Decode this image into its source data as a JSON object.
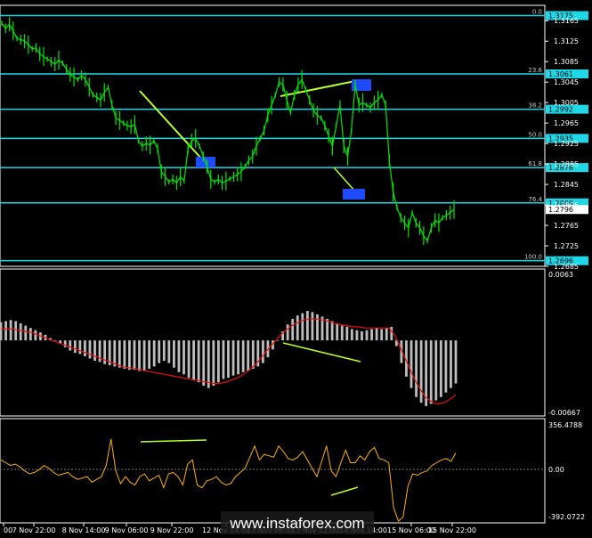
{
  "colors": {
    "background": "#000000",
    "frame": "#ffffff",
    "grid": "#2a2a2a",
    "price": "#00e600",
    "fib_line": "#1ed8e8",
    "fib_marker": "#1f4bff",
    "trend": "#b8ff2a",
    "macd_hist": "#bdbdbd",
    "macd_signal": "#e81010",
    "cci": "#ffb400",
    "label_bg_fib": "#1ed8e8",
    "label_bg_cur": "#ffffff"
  },
  "price_axis": {
    "ticks": [
      "1.3165",
      "1.3125",
      "1.3085",
      "1.3045",
      "1.3005",
      "1.2965",
      "1.2925",
      "1.2885",
      "1.2845",
      "1.2805",
      "1.2765",
      "1.2725",
      "1.2685"
    ],
    "current": "1.2796"
  },
  "fibo": [
    {
      "level": "0.0",
      "price": "1.3175"
    },
    {
      "level": "23.6",
      "price": "1.3061"
    },
    {
      "level": "38.2",
      "price": "1.2992"
    },
    {
      "level": "50.0",
      "price": "1.2935"
    },
    {
      "level": "61.8",
      "price": "1.2878"
    },
    {
      "level": "76.4",
      "price": "1.2809"
    },
    {
      "level": "100.0",
      "price": "1.2696"
    }
  ],
  "macd_axis": {
    "top": "0.0063",
    "bottom": "-0.00667"
  },
  "cci_axis": {
    "top": "356.4788",
    "mid": "0.00",
    "bottom": "-392.0722"
  },
  "time_axis": [
    "00",
    "7 Nov 22:00",
    "8 Nov 14:00",
    "9 Nov 06:00",
    "9 Nov 22:00",
    "12 Nov 14:00",
    "13 Nov 06:00",
    "13 Nov 22:00",
    "14 Nov 14:00",
    "15 Nov 06:00",
    "15 Nov 22:00"
  ],
  "watermark": "www.instaforex.com",
  "chart_data": {
    "type": "line",
    "price_series": [
      1.316,
      1.315,
      1.3158,
      1.3145,
      1.313,
      1.3128,
      1.3125,
      1.3118,
      1.311,
      1.3112,
      1.31,
      1.3095,
      1.309,
      1.3085,
      1.308,
      1.3088,
      1.3082,
      1.307,
      1.306,
      1.3055,
      1.305,
      1.3058,
      1.305,
      1.3035,
      1.302,
      1.3015,
      1.301,
      1.3025,
      1.3035,
      1.3,
      1.2975,
      1.297,
      1.2965,
      1.296,
      1.2958,
      1.2962,
      1.293,
      1.292,
      1.2925,
      1.2922,
      1.293,
      1.2915,
      1.287,
      1.286,
      1.285,
      1.2855,
      1.2848,
      1.286,
      1.2852,
      1.2915,
      1.293,
      1.2935,
      1.292,
      1.29,
      1.288,
      1.2855,
      1.285,
      1.2855,
      1.2848,
      1.2852,
      1.2856,
      1.286,
      1.2865,
      1.287,
      1.288,
      1.2892,
      1.29,
      1.292,
      1.2935,
      1.295,
      1.298,
      1.3,
      1.302,
      1.3045,
      1.304,
      1.301,
      1.2985,
      1.302,
      1.304,
      1.305,
      1.303,
      1.301,
      1.299,
      1.298,
      1.2975,
      1.296,
      1.294,
      1.292,
      1.296,
      1.3,
      1.292,
      1.29,
      1.295,
      1.304,
      1.3,
      1.3005,
      1.3,
      1.2995,
      1.3005,
      1.301,
      1.302,
      1.3,
      1.289,
      1.283,
      1.28,
      1.278,
      1.277,
      1.276,
      1.279,
      1.277,
      1.276,
      1.2745,
      1.2735,
      1.276,
      1.2775,
      1.277,
      1.278,
      1.2785,
      1.279,
      1.2796
    ],
    "price_ylim": [
      1.2685,
      1.3195
    ],
    "macd_hist": [
      0.0016,
      0.0017,
      0.0018,
      0.0017,
      0.0015,
      0.0013,
      0.0011,
      0.0009,
      0.0007,
      0.0005,
      0.0002,
      0.0,
      -0.0003,
      -0.0006,
      -0.0009,
      -0.0011,
      -0.0012,
      -0.0014,
      -0.0016,
      -0.0018,
      -0.0019,
      -0.0021,
      -0.0022,
      -0.0023,
      -0.0024,
      -0.0025,
      -0.0026,
      -0.0026,
      -0.0027,
      -0.0027,
      -0.0025,
      -0.0023,
      -0.002,
      -0.0018,
      -0.002,
      -0.0024,
      -0.0028,
      -0.003,
      -0.0033,
      -0.0035,
      -0.0037,
      -0.004,
      -0.0042,
      -0.004,
      -0.0037,
      -0.0034,
      -0.0033,
      -0.0031,
      -0.003,
      -0.0028,
      -0.0027,
      -0.0025,
      -0.0023,
      -0.002,
      -0.0015,
      -0.0008,
      0.0,
      0.0008,
      0.0014,
      0.0019,
      0.0022,
      0.0024,
      0.0026,
      0.0025,
      0.0023,
      0.0021,
      0.0019,
      0.0017,
      0.0015,
      0.0013,
      0.0012,
      0.001,
      0.0009,
      0.0008,
      0.0009,
      0.001,
      0.0011,
      0.001,
      0.0011,
      0.0012,
      -0.0005,
      -0.002,
      -0.0032,
      -0.0042,
      -0.005,
      -0.0055,
      -0.0058,
      -0.0056,
      -0.0053,
      -0.005,
      -0.0046,
      -0.0042,
      -0.0038
    ],
    "macd_signal": [
      0.001,
      0.001,
      0.001,
      0.0009,
      0.0008,
      0.0007,
      0.0005,
      0.0003,
      0.0001,
      -0.0001,
      -0.0003,
      -0.0005,
      -0.0007,
      -0.0009,
      -0.0011,
      -0.0013,
      -0.0015,
      -0.0017,
      -0.0019,
      -0.0021,
      -0.0023,
      -0.0024,
      -0.0025,
      -0.0026,
      -0.0027,
      -0.0028,
      -0.0029,
      -0.003,
      -0.0031,
      -0.0032,
      -0.0033,
      -0.0034,
      -0.0035,
      -0.0036,
      -0.0037,
      -0.0038,
      -0.0038,
      -0.0037,
      -0.0035,
      -0.0033,
      -0.003,
      -0.0026,
      -0.0021,
      -0.0015,
      -0.0008,
      -0.0002,
      0.0004,
      0.0009,
      0.0013,
      0.0016,
      0.0018,
      0.0019,
      0.0019,
      0.0018,
      0.0017,
      0.0015,
      0.0014,
      0.0013,
      0.0012,
      0.0012,
      0.0011,
      0.0011,
      0.0011,
      0.0011,
      0.0011,
      0.0004,
      -0.0008,
      -0.002,
      -0.0032,
      -0.0042,
      -0.005,
      -0.0054,
      -0.0056,
      -0.0055,
      -0.0052,
      -0.0048
    ],
    "macd_ylim": [
      -0.00667,
      0.0063
    ],
    "cci": [
      60,
      40,
      20,
      30,
      10,
      -20,
      -40,
      -30,
      -10,
      20,
      0,
      -30,
      -50,
      -40,
      -30,
      -60,
      -80,
      -70,
      -60,
      -100,
      -80,
      -60,
      20,
      210,
      -20,
      -110,
      -60,
      -100,
      -120,
      -60,
      -40,
      -90,
      -70,
      -50,
      -140,
      -40,
      -30,
      -60,
      -120,
      30,
      60,
      -120,
      -140,
      -90,
      -80,
      -60,
      -100,
      -120,
      -110,
      -60,
      -30,
      0,
      80,
      160,
      60,
      100,
      90,
      80,
      160,
      120,
      70,
      60,
      80,
      120,
      60,
      0,
      -60,
      50,
      160,
      -20,
      -60,
      40,
      130,
      40,
      40,
      90,
      60,
      120,
      150,
      70,
      60,
      40,
      -280,
      -380,
      -350,
      -130,
      -40,
      -50,
      -30,
      -20,
      20,
      40,
      60,
      70,
      50,
      110
    ],
    "cci_ylim": [
      -392.0722,
      356.4788
    ]
  }
}
